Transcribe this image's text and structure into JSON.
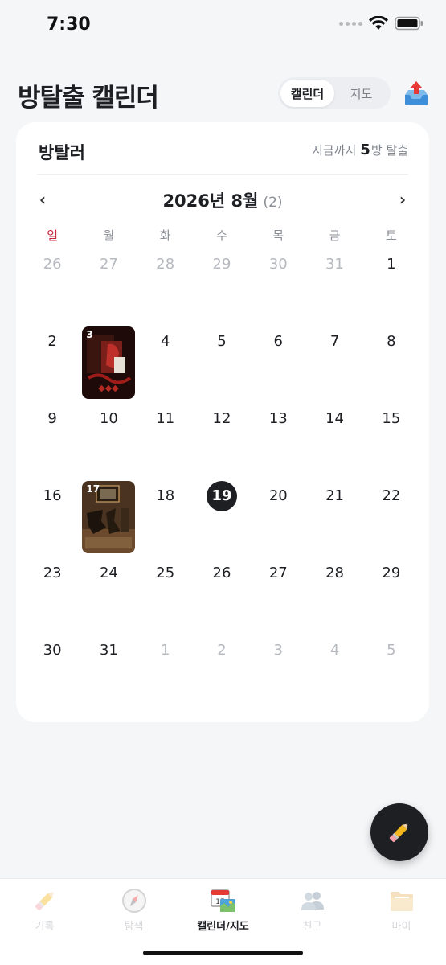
{
  "status_bar": {
    "time": "7:30"
  },
  "header": {
    "title": "방탈출 캘린더",
    "segments": [
      {
        "label": "캘린더",
        "active": true
      },
      {
        "label": "지도",
        "active": false
      }
    ],
    "share_icon": "upload-inbox-icon"
  },
  "card": {
    "title": "방탈러",
    "summary_prefix": "지금까지",
    "summary_count": "5",
    "summary_suffix": "방 탈출"
  },
  "calendar": {
    "prev_label": "‹",
    "next_label": "›",
    "month_label": "2026년 8월",
    "month_count": "(2)",
    "weekdays": [
      "일",
      "월",
      "화",
      "수",
      "목",
      "금",
      "토"
    ],
    "today": "19",
    "days": [
      {
        "d": "26",
        "other": true
      },
      {
        "d": "27",
        "other": true
      },
      {
        "d": "28",
        "other": true
      },
      {
        "d": "29",
        "other": true
      },
      {
        "d": "30",
        "other": true
      },
      {
        "d": "31",
        "other": true
      },
      {
        "d": "1"
      },
      {
        "d": "2"
      },
      {
        "d": "3",
        "poster": "red"
      },
      {
        "d": "4"
      },
      {
        "d": "5"
      },
      {
        "d": "6"
      },
      {
        "d": "7"
      },
      {
        "d": "8"
      },
      {
        "d": "9"
      },
      {
        "d": "10"
      },
      {
        "d": "11"
      },
      {
        "d": "12"
      },
      {
        "d": "13"
      },
      {
        "d": "14"
      },
      {
        "d": "15"
      },
      {
        "d": "16"
      },
      {
        "d": "17",
        "poster": "brown"
      },
      {
        "d": "18"
      },
      {
        "d": "19",
        "today": true
      },
      {
        "d": "20"
      },
      {
        "d": "21"
      },
      {
        "d": "22"
      },
      {
        "d": "23"
      },
      {
        "d": "24"
      },
      {
        "d": "25"
      },
      {
        "d": "26"
      },
      {
        "d": "27"
      },
      {
        "d": "28"
      },
      {
        "d": "29"
      },
      {
        "d": "30"
      },
      {
        "d": "31"
      },
      {
        "d": "1",
        "other": true
      },
      {
        "d": "2",
        "other": true
      },
      {
        "d": "3",
        "other": true
      },
      {
        "d": "4",
        "other": true
      },
      {
        "d": "5",
        "other": true
      }
    ]
  },
  "fab": {
    "icon": "pencil-icon"
  },
  "tabs": [
    {
      "label": "기록",
      "icon": "pencil-icon",
      "active": false
    },
    {
      "label": "탐색",
      "icon": "compass-icon",
      "active": false
    },
    {
      "label": "캘린더/지도",
      "icon": "calendar-map-icon",
      "active": true
    },
    {
      "label": "친구",
      "icon": "friends-icon",
      "active": false
    },
    {
      "label": "마이",
      "icon": "folder-icon",
      "active": false
    }
  ],
  "colors": {
    "accent": "#1d1f23",
    "sunday": "#c8283c",
    "background": "#f5f6f8"
  }
}
